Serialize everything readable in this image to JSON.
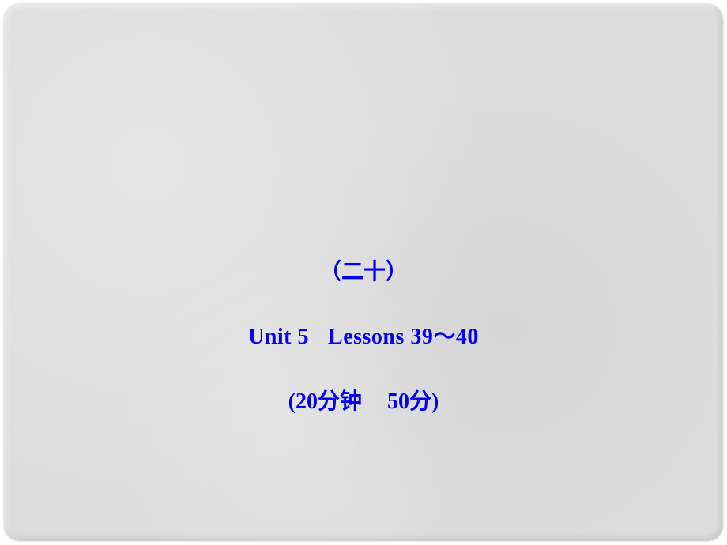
{
  "slide": {
    "line1": "（二十）",
    "line2_prefix": "Unit 5",
    "line2_suffix": "Lessons 39～40",
    "line3_prefix": "(20分钟",
    "line3_suffix": "50分)"
  }
}
